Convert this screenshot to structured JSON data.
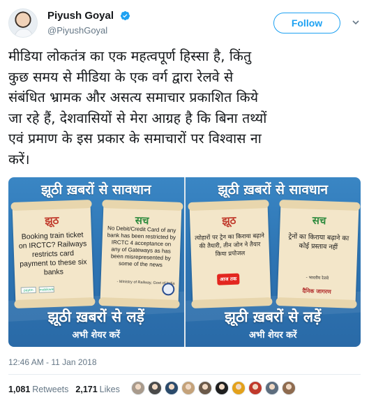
{
  "author": {
    "name": "Piyush Goyal",
    "handle": "@PiyushGoyal",
    "verified": true
  },
  "follow_button": {
    "label": "Follow",
    "color": "#1da1f2"
  },
  "tweet": {
    "lines": [
      "मीडिया लोकतंत्र का एक महत्वपूर्ण हिस्सा है, किंतु",
      "कुछ समय से मीडिया के एक वर्ग द्वारा रेलवे से",
      "संबंधित भ्रामक और असत्य समाचार प्रकाशित किये",
      "जा रहे हैं, देशवासियों से मेरा आग्रह है कि बिना तथ्यों",
      "एवं प्रमाण के इस प्रकार के समाचारों पर विश्वास ना",
      "करें।"
    ]
  },
  "media": [
    {
      "title": "झूठी ख़बरों से सावधान",
      "fake": {
        "heading": "झूठ",
        "text": "Booking train ticket on IRCTC? Railways restricts card payment to these six banks",
        "logos": [
          "paytm",
          "mobikwik"
        ]
      },
      "fact": {
        "heading": "सच",
        "text": "No Debit/Credit Card of any bank has been restricted by IRCTC 4 acceptance on any of Gateways as has been misrepresented by some of the news",
        "credit": "- Ministry of Railway, Govt of India"
      },
      "bottom": "झूठी ख़बरों से लड़ें",
      "share": "अभी शेयर करें"
    },
    {
      "title": "झूठी ख़बरों से सावधान",
      "fake": {
        "heading": "झूठ",
        "text": "त्योहारों पर ट्रेन का किराया बढ़ाने की तैयारी, तीन जोन ने तैयार किया प्रपोजल",
        "logo": "आज तक"
      },
      "fact": {
        "heading": "सच",
        "text": "ट्रेनों का किराया बढ़ाने का कोई प्रस्ताव नहीं",
        "credit": "- भारतीय रेलवे",
        "logo": "दैनिक जागरण"
      },
      "bottom": "झूठी ख़बरों से लड़ें",
      "share": "अभी शेयर करें"
    }
  ],
  "timestamp": "12:46 AM - 11 Jan 2018",
  "stats": {
    "retweets_count": "1,081",
    "retweets_label": "Retweets",
    "likes_count": "2,171",
    "likes_label": "Likes"
  },
  "likers": [
    {
      "icon": "avatar",
      "color": "#a89a8c"
    },
    {
      "icon": "avatar",
      "color": "#4a4a4a"
    },
    {
      "icon": "avatar",
      "color": "#2b4a6b"
    },
    {
      "icon": "avatar",
      "color": "#c4a27a"
    },
    {
      "icon": "avatar",
      "color": "#6b5a4a"
    },
    {
      "icon": "avatar",
      "color": "#1f1f1f"
    },
    {
      "icon": "avatar",
      "color": "#e3a11b"
    },
    {
      "icon": "avatar",
      "color": "#c0392b"
    },
    {
      "icon": "avatar",
      "color": "#5d6d7e"
    },
    {
      "icon": "avatar",
      "color": "#8e6b4f"
    }
  ]
}
